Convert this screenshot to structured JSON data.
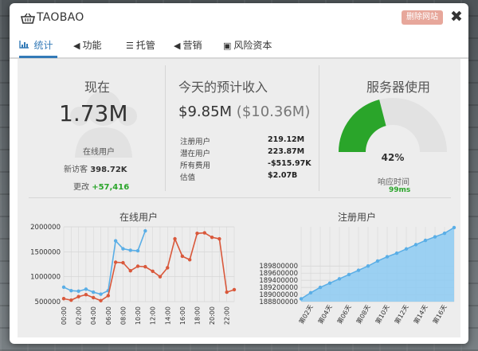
{
  "app": {
    "title": "TAOBAO",
    "remove_label": "删除网站",
    "close_icon": "✖"
  },
  "tabs": [
    {
      "label": "统计",
      "icon": "bar-chart-icon",
      "active": true
    },
    {
      "label": "功能",
      "icon": "megaphone-icon"
    },
    {
      "label": "托管",
      "icon": "server-icon"
    },
    {
      "label": "营销",
      "icon": "megaphone-icon"
    },
    {
      "label": "风险资本",
      "icon": "money-icon"
    }
  ],
  "now": {
    "title": "现在",
    "big": "1.73M",
    "sub": "在线用户",
    "visitors_label": "新访客",
    "visitors_value": "398.72K",
    "change_label": "更改",
    "change_value": "+57,416"
  },
  "revenue": {
    "title": "今天的预计收入",
    "main": "$9.85M",
    "paren": "($10.36M)",
    "rows": [
      {
        "label": "注册用户",
        "value": "219.12M"
      },
      {
        "label": "潜在用户",
        "value": "223.87M"
      },
      {
        "label": "所有费用",
        "value": "-$515.97K"
      },
      {
        "label": "估值",
        "value": "$2.07B"
      }
    ]
  },
  "server": {
    "title": "服务器使用",
    "percent_text": "42%",
    "percent_value": 42,
    "latency_label": "响应时间",
    "latency_value": "99ms",
    "colors": {
      "fill": "#2aa52a",
      "track": "#e2e2e2"
    }
  },
  "chart_data": [
    {
      "type": "line",
      "title": "在线用户",
      "x": [
        "00:00",
        "01:00",
        "02:00",
        "03:00",
        "04:00",
        "05:00",
        "06:00",
        "07:00",
        "08:00",
        "09:00",
        "10:00",
        "11:00",
        "12:00",
        "13:00",
        "14:00",
        "15:00",
        "16:00",
        "17:00",
        "18:00",
        "19:00",
        "20:00",
        "21:00",
        "22:00",
        "23:00"
      ],
      "x_tick_labels": [
        "00:00",
        "02:00",
        "04:00",
        "06:00",
        "08:00",
        "10:00",
        "12:00",
        "14:00",
        "16:00",
        "18:00",
        "20:00",
        "22:00"
      ],
      "ylim": [
        500000,
        2000000
      ],
      "y_ticks": [
        "2000000",
        "1500000",
        "1000000",
        "500000"
      ],
      "series": [
        {
          "color": "#5aaee6",
          "values": [
            790000,
            720000,
            710000,
            750000,
            690000,
            650000,
            720000,
            1720000,
            1560000,
            1530000,
            1520000,
            1920000,
            null,
            null,
            null,
            null,
            null,
            null,
            null,
            null,
            null,
            null,
            null,
            null
          ]
        },
        {
          "color": "#d9583b",
          "values": [
            560000,
            530000,
            600000,
            640000,
            580000,
            520000,
            620000,
            1290000,
            1280000,
            1120000,
            1210000,
            1200000,
            1110000,
            1000000,
            1180000,
            1760000,
            1410000,
            1340000,
            1870000,
            1880000,
            1790000,
            1760000,
            690000,
            740000
          ]
        }
      ],
      "grid": true
    },
    {
      "type": "area",
      "title": "注册用户",
      "categories": [
        "第1天",
        "第2天",
        "第3天",
        "第4天",
        "第5天",
        "第6天",
        "第7天",
        "第8天",
        "第9天",
        "第10天",
        "第11天",
        "第12天",
        "第13天",
        "第14天",
        "第15天",
        "第16天",
        "第17天"
      ],
      "x_tick_labels": [
        "第02天",
        "第04天",
        "第06天",
        "第08天",
        "第10天",
        "第12天",
        "第14天",
        "第16天"
      ],
      "values": [
        188880000,
        189050000,
        189200000,
        189320000,
        189440000,
        189560000,
        189680000,
        189800000,
        189940000,
        190060000,
        190160000,
        190280000,
        190400000,
        190520000,
        190620000,
        190720000,
        190880000
      ],
      "ylim": [
        188800000,
        190900000
      ],
      "y_ticks": [
        "189800000",
        "189600000",
        "189400000",
        "189200000",
        "189000000",
        "188800000"
      ],
      "color": "#5aaee6",
      "fill": "#8ccaf2",
      "grid": true
    }
  ]
}
